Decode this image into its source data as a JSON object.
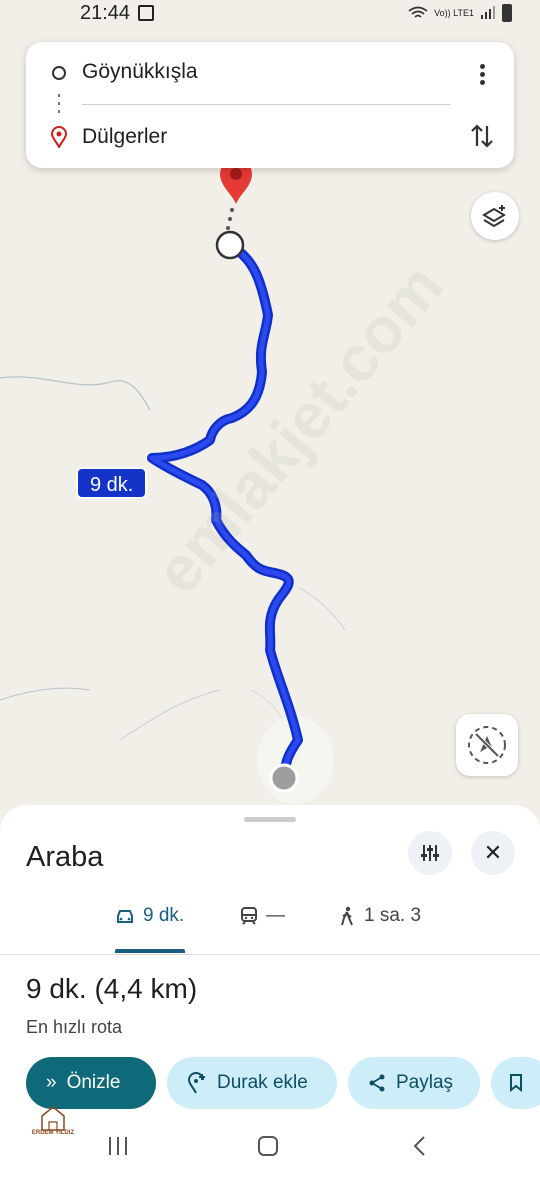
{
  "status_bar": {
    "time": "21:44",
    "network": "Vo)) LTE1"
  },
  "route": {
    "origin": "Göynükkışla",
    "destination": "Dülgerler"
  },
  "map": {
    "route_time_label": "9 dk.",
    "watermark": "emlakjet.com",
    "route_color": "#1f35d6"
  },
  "sheet": {
    "title": "Araba",
    "tabs": [
      {
        "icon": "car-icon",
        "label": "9 dk."
      },
      {
        "icon": "transit-icon",
        "label": "—"
      },
      {
        "icon": "walk-icon",
        "label": "1 sa. 3"
      }
    ],
    "summary_time": "9 dk.",
    "summary_distance": "(4,4 km)",
    "subtitle": "En hızlı rota",
    "actions": {
      "preview": "Önizle",
      "add_stop": "Durak ekle",
      "share": "Paylaş"
    }
  },
  "logo": {
    "text": "ERDEM YILDIZ"
  },
  "colors": {
    "accent": "#0e6a78",
    "chip_light": "#cdeef9",
    "tab_active": "#1a5e7e"
  }
}
